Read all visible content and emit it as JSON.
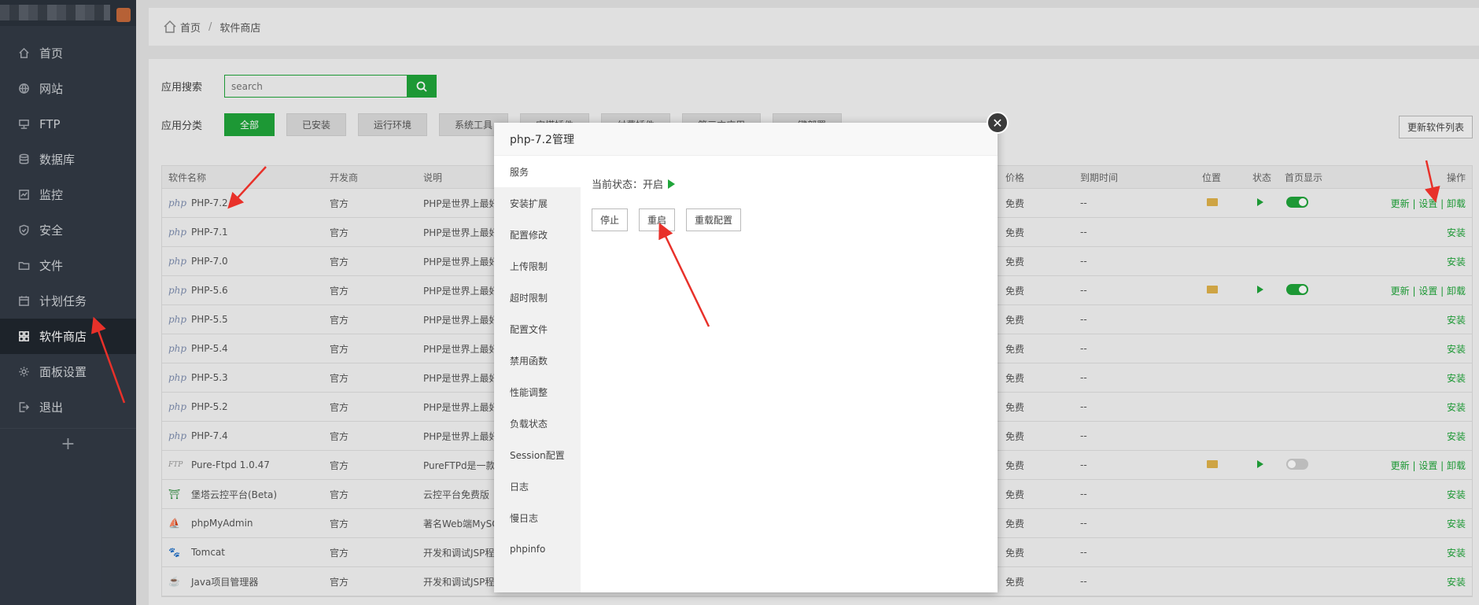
{
  "sidebar": {
    "items": [
      {
        "label": "首页",
        "icon": "home-icon"
      },
      {
        "label": "网站",
        "icon": "globe-icon"
      },
      {
        "label": "FTP",
        "icon": "ftp-icon"
      },
      {
        "label": "数据库",
        "icon": "database-icon"
      },
      {
        "label": "监控",
        "icon": "monitor-icon"
      },
      {
        "label": "安全",
        "icon": "shield-icon"
      },
      {
        "label": "文件",
        "icon": "folder-icon"
      },
      {
        "label": "计划任务",
        "icon": "calendar-icon"
      },
      {
        "label": "软件商店",
        "icon": "grid-icon",
        "active": true
      },
      {
        "label": "面板设置",
        "icon": "gear-icon"
      },
      {
        "label": "退出",
        "icon": "logout-icon"
      }
    ],
    "add_label": "+"
  },
  "breadcrumb": {
    "home": "首页",
    "sep": "/",
    "current": "软件商店"
  },
  "search": {
    "label": "应用搜索",
    "placeholder": "search"
  },
  "category": {
    "label": "应用分类",
    "items": [
      "全部",
      "已安装",
      "运行环境",
      "系统工具",
      "宝塔插件",
      "付费插件",
      "第三方应用",
      "一键部署"
    ],
    "update_button": "更新软件列表"
  },
  "table": {
    "headers": {
      "name": "软件名称",
      "dev": "开发商",
      "desc": "说明",
      "price": "价格",
      "exp": "到期时间",
      "pos": "位置",
      "stat": "状态",
      "home": "首页显示",
      "op": "操作"
    },
    "rows": [
      {
        "icon": "php",
        "name": "PHP-7.2",
        "dev": "官方",
        "desc": "PHP是世界上最好的编程语言",
        "price": "免费",
        "exp": "--",
        "installed": true,
        "toggle": "on",
        "op": "更新 | 设置 | 卸载"
      },
      {
        "icon": "php",
        "name": "PHP-7.1",
        "dev": "官方",
        "desc": "PHP是世界上最好的编程语言",
        "price": "免费",
        "exp": "--",
        "installed": false,
        "op": "安装"
      },
      {
        "icon": "php",
        "name": "PHP-7.0",
        "dev": "官方",
        "desc": "PHP是世界上最好的编程语言",
        "price": "免费",
        "exp": "--",
        "installed": false,
        "op": "安装"
      },
      {
        "icon": "php",
        "name": "PHP-5.6",
        "dev": "官方",
        "desc": "PHP是世界上最好的编程语言",
        "price": "免费",
        "exp": "--",
        "installed": true,
        "toggle": "on",
        "op": "更新 | 设置 | 卸载"
      },
      {
        "icon": "php",
        "name": "PHP-5.5",
        "dev": "官方",
        "desc": "PHP是世界上最好的编程语言",
        "price": "免费",
        "exp": "--",
        "installed": false,
        "op": "安装"
      },
      {
        "icon": "php",
        "name": "PHP-5.4",
        "dev": "官方",
        "desc": "PHP是世界上最好的编程语言",
        "price": "免费",
        "exp": "--",
        "installed": false,
        "op": "安装"
      },
      {
        "icon": "php",
        "name": "PHP-5.3",
        "dev": "官方",
        "desc": "PHP是世界上最好的编程语言",
        "price": "免费",
        "exp": "--",
        "installed": false,
        "op": "安装"
      },
      {
        "icon": "php",
        "name": "PHP-5.2",
        "dev": "官方",
        "desc": "PHP是世界上最好的编程语言",
        "price": "免费",
        "exp": "--",
        "installed": false,
        "op": "安装"
      },
      {
        "icon": "php",
        "name": "PHP-7.4",
        "dev": "官方",
        "desc": "PHP是世界上最好的编程语言",
        "price": "免费",
        "exp": "--",
        "installed": false,
        "op": "安装"
      },
      {
        "icon": "ftp",
        "name": "Pure-Ftpd 1.0.47",
        "dev": "官方",
        "desc": "PureFTPd是一款专注于程序健壮和软件安全的免费FTP服务器软件",
        "price": "免费",
        "exp": "--",
        "installed": true,
        "toggle": "off",
        "op": "更新 | 设置 | 卸载"
      },
      {
        "icon": "tower",
        "name": "堡塔云控平台(Beta)",
        "dev": "官方",
        "desc": "云控平台免费版",
        "price": "免费",
        "exp": "--",
        "installed": false,
        "op": "安装"
      },
      {
        "icon": "pma",
        "name": "phpMyAdmin",
        "dev": "官方",
        "desc": "著名Web端MySQL管理工具",
        "price": "免费",
        "exp": "--",
        "installed": false,
        "op": "安装"
      },
      {
        "icon": "tomcat",
        "name": "Tomcat",
        "dev": "官方",
        "desc": "开发和调试JSP程序的首选",
        "price": "免费",
        "exp": "--",
        "installed": false,
        "op": "安装"
      },
      {
        "icon": "java",
        "name": "Java项目管理器",
        "dev": "官方",
        "desc": "开发和调试JSP程序",
        "price": "免费",
        "exp": "--",
        "installed": false,
        "op": "安装"
      }
    ]
  },
  "modal": {
    "title": "php-7.2管理",
    "close": "✕",
    "menu": [
      "服务",
      "安装扩展",
      "配置修改",
      "上传限制",
      "超时限制",
      "配置文件",
      "禁用函数",
      "性能调整",
      "负载状态",
      "Session配置",
      "日志",
      "慢日志",
      "phpinfo"
    ],
    "status_label": "当前状态：",
    "status_value": "开启",
    "buttons": [
      "停止",
      "重启",
      "重载配置"
    ]
  },
  "colors": {
    "accent": "#20a53a",
    "sidebar": "#323a45",
    "arrow": "#e8312a"
  }
}
